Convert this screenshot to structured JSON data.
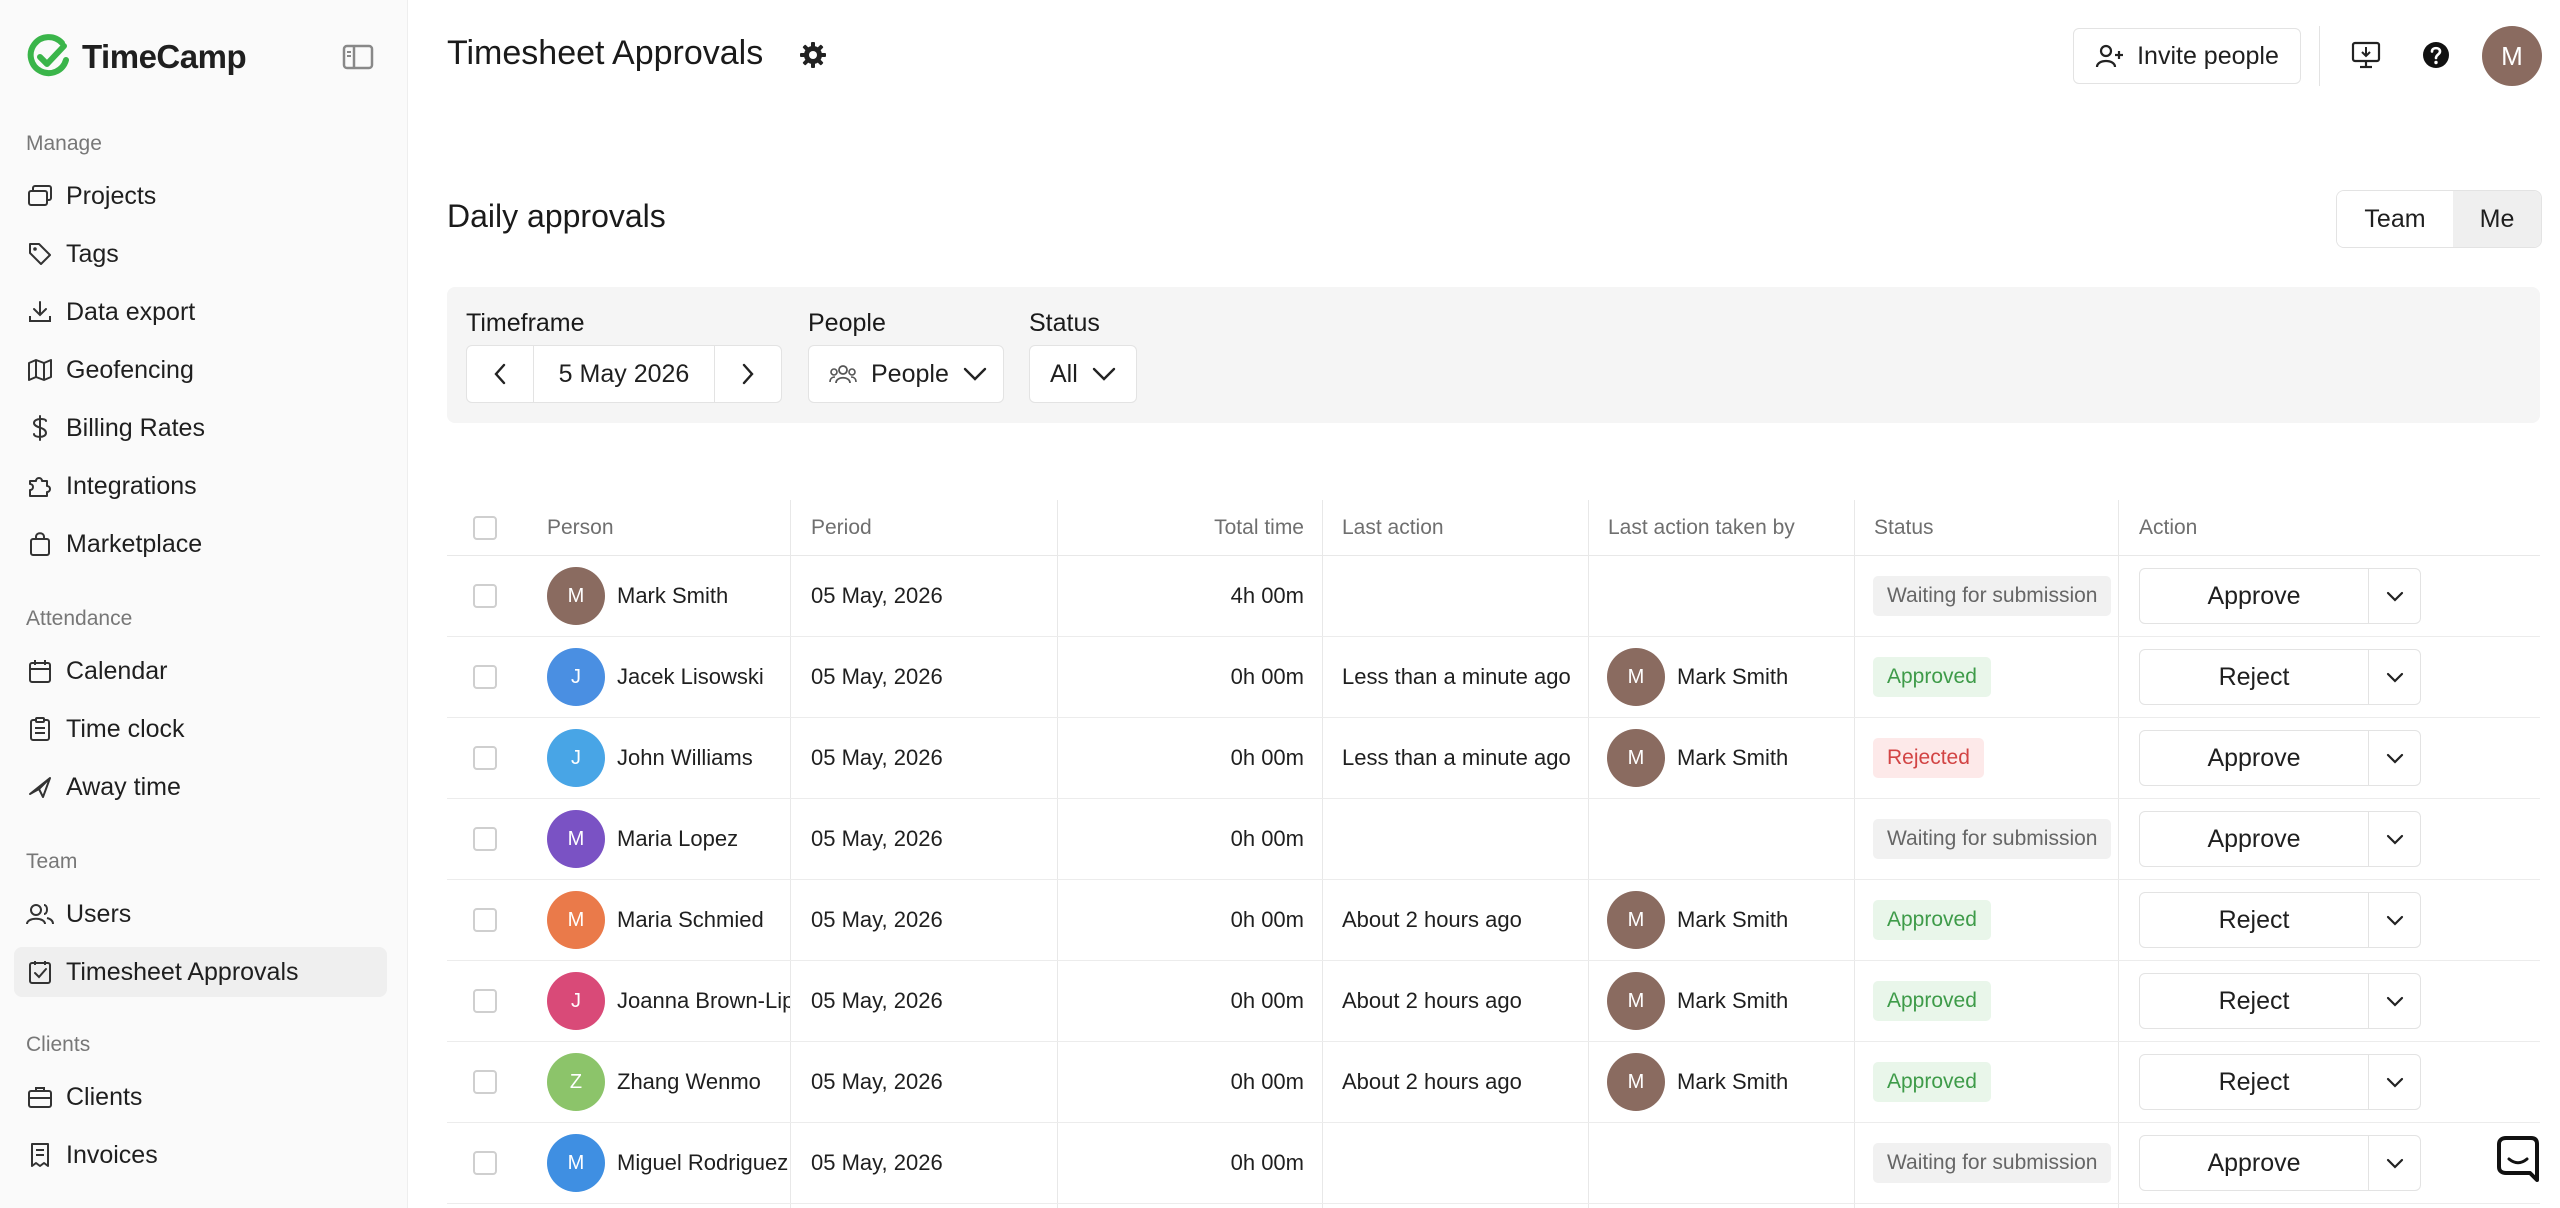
{
  "app": {
    "name": "TimeCamp",
    "brand_color": "#3ab54a"
  },
  "sidebar": {
    "sections": [
      {
        "label": "Manage",
        "items": [
          {
            "label": "Projects",
            "icon": "projects-icon"
          },
          {
            "label": "Tags",
            "icon": "tag-icon"
          },
          {
            "label": "Data export",
            "icon": "download-icon"
          },
          {
            "label": "Geofencing",
            "icon": "map-icon"
          },
          {
            "label": "Billing Rates",
            "icon": "dollar-icon"
          },
          {
            "label": "Integrations",
            "icon": "puzzle-icon"
          },
          {
            "label": "Marketplace",
            "icon": "bag-icon"
          }
        ]
      },
      {
        "label": "Attendance",
        "items": [
          {
            "label": "Calendar",
            "icon": "calendar-icon"
          },
          {
            "label": "Time clock",
            "icon": "clipboard-icon"
          },
          {
            "label": "Away time",
            "icon": "plane-icon"
          }
        ]
      },
      {
        "label": "Team",
        "items": [
          {
            "label": "Users",
            "icon": "users-icon"
          },
          {
            "label": "Timesheet Approvals",
            "icon": "checklist-icon",
            "active": true
          }
        ]
      },
      {
        "label": "Clients",
        "items": [
          {
            "label": "Clients",
            "icon": "briefcase-icon"
          },
          {
            "label": "Invoices",
            "icon": "invoice-icon"
          }
        ]
      }
    ]
  },
  "header": {
    "title": "Timesheet Approvals",
    "invite_label": "Invite people",
    "user_initial": "M"
  },
  "sub": {
    "title": "Daily approvals",
    "toggle": {
      "team": "Team",
      "me": "Me",
      "selected": "Me"
    }
  },
  "filters": {
    "timeframe_label": "Timeframe",
    "date": "5 May 2026",
    "people_label": "People",
    "people_value": "People",
    "status_label": "Status",
    "status_value": "All"
  },
  "table": {
    "columns": [
      "Person",
      "Period",
      "Total time",
      "Last action",
      "Last action taken by",
      "Status",
      "Action"
    ],
    "rows": [
      {
        "initial": "M",
        "color": "#8a6b60",
        "person": "Mark Smith",
        "period": "05 May, 2026",
        "total": "4h 00m",
        "last_action": "",
        "by_initial": "",
        "by": "",
        "status": "Waiting for submission",
        "status_type": "waiting",
        "action": "Approve"
      },
      {
        "initial": "J",
        "color": "#4a8fe2",
        "person": "Jacek Lisowski",
        "period": "05 May, 2026",
        "total": "0h 00m",
        "last_action": "Less than a minute ago",
        "by_initial": "M",
        "by": "Mark Smith",
        "status": "Approved",
        "status_type": "approved",
        "action": "Reject"
      },
      {
        "initial": "J",
        "color": "#48a5e6",
        "person": "John Williams",
        "period": "05 May, 2026",
        "total": "0h 00m",
        "last_action": "Less than a minute ago",
        "by_initial": "M",
        "by": "Mark Smith",
        "status": "Rejected",
        "status_type": "rejected",
        "action": "Approve"
      },
      {
        "initial": "M",
        "color": "#7a52c4",
        "person": "Maria Lopez",
        "period": "05 May, 2026",
        "total": "0h 00m",
        "last_action": "",
        "by_initial": "",
        "by": "",
        "status": "Waiting for submission",
        "status_type": "waiting",
        "action": "Approve"
      },
      {
        "initial": "M",
        "color": "#ea7a4a",
        "person": "Maria Schmied",
        "period": "05 May, 2026",
        "total": "0h 00m",
        "last_action": "About 2 hours ago",
        "by_initial": "M",
        "by": "Mark Smith",
        "status": "Approved",
        "status_type": "approved",
        "action": "Reject"
      },
      {
        "initial": "J",
        "color": "#d94a78",
        "person": "Joanna Brown-Lip",
        "period": "05 May, 2026",
        "total": "0h 00m",
        "last_action": "About 2 hours ago",
        "by_initial": "M",
        "by": "Mark Smith",
        "status": "Approved",
        "status_type": "approved",
        "action": "Reject"
      },
      {
        "initial": "Z",
        "color": "#8cc46a",
        "person": "Zhang Wenmo",
        "period": "05 May, 2026",
        "total": "0h 00m",
        "last_action": "About 2 hours ago",
        "by_initial": "M",
        "by": "Mark Smith",
        "status": "Approved",
        "status_type": "approved",
        "action": "Reject"
      },
      {
        "initial": "M",
        "color": "#3f8fe2",
        "person": "Miguel Rodriguez",
        "period": "05 May, 2026",
        "total": "0h 00m",
        "last_action": "",
        "by_initial": "",
        "by": "",
        "status": "Waiting for submission",
        "status_type": "waiting",
        "action": "Approve"
      }
    ]
  }
}
